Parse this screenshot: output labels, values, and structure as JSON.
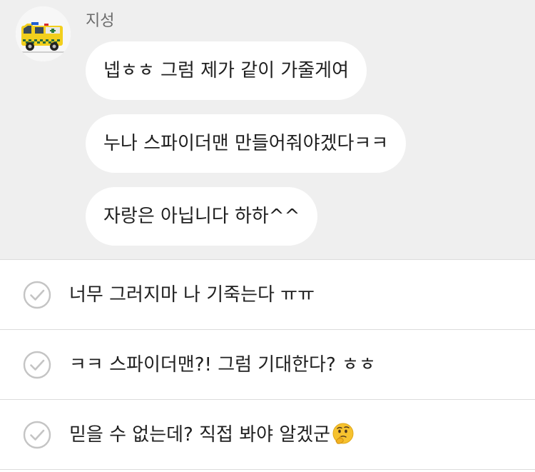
{
  "chat": {
    "sender_name": "지성",
    "avatar_icon": "ambulance-toy-avatar",
    "messages": [
      {
        "text": "넵ㅎㅎ 그럼 제가 같이 가줄게여"
      },
      {
        "text": "누나 스파이더맨 만들어줘야겠다ㅋㅋ"
      },
      {
        "text": "자랑은 아닙니다 하하^^"
      }
    ],
    "background_color": "#efefef",
    "bubble_color": "#ffffff"
  },
  "reply_options": [
    {
      "text": "너무 그러지마 나 기죽는다 ㅠㅠ",
      "icon": "check-circle-icon"
    },
    {
      "text": "ㅋㅋ 스파이더맨?! 그럼 기대한다? ㅎㅎ",
      "icon": "check-circle-icon"
    },
    {
      "text": "믿을 수 없는데? 직접 봐야 알겠군",
      "icon": "check-circle-icon",
      "trailing_emoji": "thinking-face-emoji"
    }
  ]
}
